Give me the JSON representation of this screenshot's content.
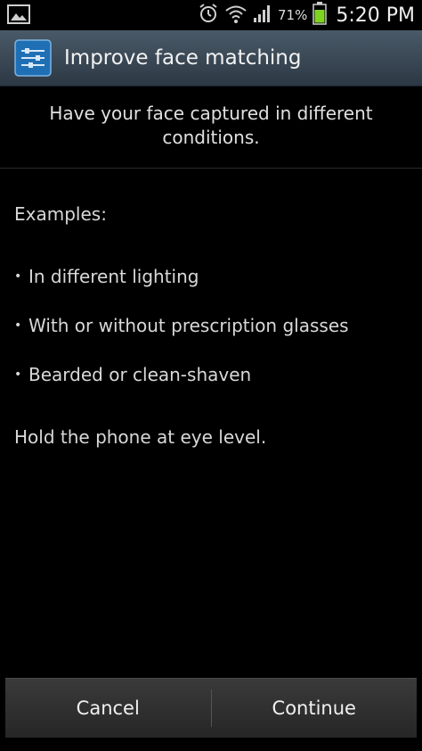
{
  "status_bar": {
    "battery_percent": "71%",
    "time": "5:20 PM",
    "icons": [
      "gallery-icon",
      "alarm-icon",
      "wifi-icon",
      "signal-icon",
      "battery-icon"
    ],
    "battery_color": "#7ed321"
  },
  "title_bar": {
    "title": "Improve face matching",
    "accent": "#4a5a68"
  },
  "content": {
    "subtitle": "Have your face captured in different conditions.",
    "examples_label": "Examples:",
    "examples": [
      "In different lighting",
      "With or without prescription glasses",
      "Bearded or clean-shaven"
    ],
    "hint": "Hold the phone at eye level."
  },
  "buttons": {
    "cancel": "Cancel",
    "continue": "Continue"
  }
}
